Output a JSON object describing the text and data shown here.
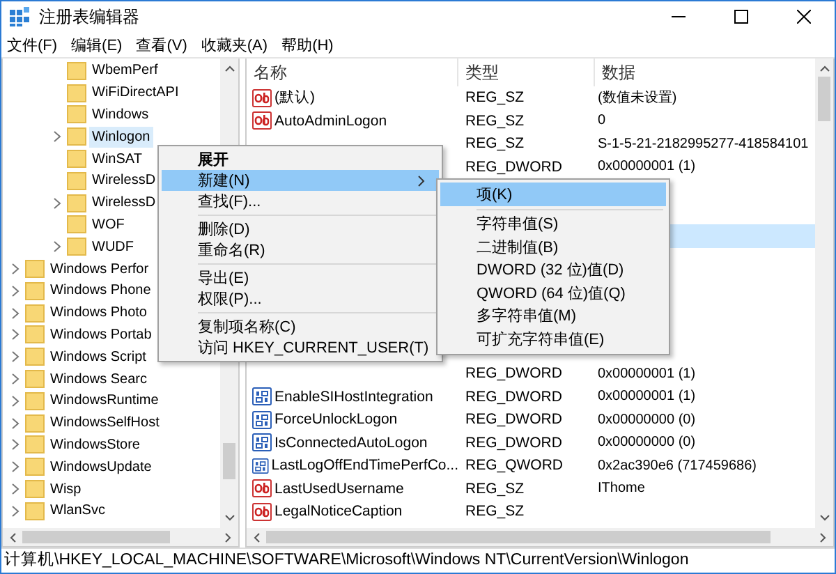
{
  "window": {
    "title": "注册表编辑器"
  },
  "menubar": [
    "文件(F)",
    "编辑(E)",
    "查看(V)",
    "收藏夹(A)",
    "帮助(H)"
  ],
  "tree": {
    "items": [
      {
        "children": [
          {
            "label": "WbemPerf",
            "has_children": false,
            "selected": false
          },
          {
            "label": "WiFiDirectAPI",
            "has_children": false,
            "selected": false
          },
          {
            "label": "Windows",
            "has_children": false,
            "selected": false
          },
          {
            "label": "Winlogon",
            "has_children": true,
            "selected": true
          },
          {
            "label": "WinSAT",
            "has_children": false,
            "selected": false
          },
          {
            "label": "WirelessD",
            "has_children": false,
            "selected": false
          },
          {
            "label": "WirelessD",
            "has_children": true,
            "selected": false
          },
          {
            "label": "WOF",
            "has_children": false,
            "selected": false
          },
          {
            "label": "WUDF",
            "has_children": true,
            "selected": false
          }
        ]
      },
      {
        "label": "Windows Perfor",
        "has_children": true,
        "selected": false
      },
      {
        "label": "Windows Phone",
        "has_children": true,
        "selected": false
      },
      {
        "label": "Windows Photo",
        "has_children": true,
        "selected": false
      },
      {
        "label": "Windows Portab",
        "has_children": true,
        "selected": false
      },
      {
        "label": "Windows Script",
        "has_children": true,
        "selected": false
      },
      {
        "label": "Windows Searc",
        "has_children": true,
        "selected": false
      },
      {
        "label": "WindowsRuntime",
        "has_children": true,
        "selected": false
      },
      {
        "label": "WindowsSelfHost",
        "has_children": true,
        "selected": false
      },
      {
        "label": "WindowsStore",
        "has_children": true,
        "selected": false
      },
      {
        "label": "WindowsUpdate",
        "has_children": true,
        "selected": false
      },
      {
        "label": "Wisp",
        "has_children": true,
        "selected": false
      },
      {
        "label": "WlanSvc",
        "has_children": true,
        "selected": false
      }
    ]
  },
  "list": {
    "columns": [
      "名称",
      "类型",
      "数据"
    ],
    "rows": [
      {
        "kind": "string",
        "name": "(默认)",
        "type": "REG_SZ",
        "data": "(数值未设置)",
        "selected": false
      },
      {
        "kind": "string",
        "name": "AutoAdminLogon",
        "type": "REG_SZ",
        "data": "0",
        "selected": false
      },
      {
        "type": "REG_SZ",
        "data": "S-1-5-21-2182995277-418584101",
        "selected": false
      },
      {
        "type": "REG_DWORD",
        "data": "0x00000001 (1)",
        "selected": false
      },
      {
        "selected": false
      },
      {
        "selected": false
      },
      {
        "selected": true
      },
      {
        "selected": false
      },
      {
        "selected": false
      },
      {
        "selected": false
      },
      {
        "selected": false
      },
      {
        "selected": false
      },
      {
        "type": "REG_DWORD",
        "data": "0x00000001 (1)",
        "selected": false
      },
      {
        "kind": "binary",
        "name": "EnableSIHostIntegration",
        "type": "REG_DWORD",
        "data": "0x00000001 (1)",
        "selected": false
      },
      {
        "kind": "binary",
        "name": "ForceUnlockLogon",
        "type": "REG_DWORD",
        "data": "0x00000000 (0)",
        "selected": false
      },
      {
        "kind": "binary",
        "name": "IsConnectedAutoLogon",
        "type": "REG_DWORD",
        "data": "0x00000000 (0)",
        "selected": false
      },
      {
        "kind": "binary",
        "name": "LastLogOffEndTimePerfCo...",
        "type": "REG_QWORD",
        "data": "0x2ac390e6 (717459686)",
        "selected": false
      },
      {
        "kind": "string",
        "name": "LastUsedUsername",
        "type": "REG_SZ",
        "data": "IThome",
        "selected": false
      },
      {
        "kind": "string",
        "name": "LegalNoticeCaption",
        "type": "REG_SZ",
        "selected": false
      }
    ]
  },
  "context_menu": {
    "items": [
      {
        "kind": "item",
        "label": "展开",
        "default": true,
        "selected": false
      },
      {
        "kind": "item",
        "label": "新建(N)",
        "submenu": true,
        "selected": true
      },
      {
        "kind": "item",
        "label": "查找(F)...",
        "selected": false
      },
      {
        "kind": "separator"
      },
      {
        "kind": "item",
        "label": "删除(D)",
        "selected": false
      },
      {
        "kind": "item",
        "label": "重命名(R)",
        "selected": false
      },
      {
        "kind": "separator"
      },
      {
        "kind": "item",
        "label": "导出(E)",
        "selected": false
      },
      {
        "kind": "item",
        "label": "权限(P)...",
        "selected": false
      },
      {
        "kind": "separator"
      },
      {
        "kind": "item",
        "label": "复制项名称(C)",
        "selected": false
      },
      {
        "kind": "item",
        "label": "访问 HKEY_CURRENT_USER(T)",
        "selected": false
      }
    ]
  },
  "submenu": {
    "items": [
      {
        "kind": "item",
        "label": "项(K)",
        "selected": true
      },
      {
        "kind": "separator"
      },
      {
        "kind": "item",
        "label": "字符串值(S)",
        "selected": false
      },
      {
        "kind": "item",
        "label": "二进制值(B)",
        "selected": false
      },
      {
        "kind": "item",
        "label": "DWORD (32 位)值(D)",
        "selected": false
      },
      {
        "kind": "item",
        "label": "QWORD (64 位)值(Q)",
        "selected": false
      },
      {
        "kind": "item",
        "label": "多字符串值(M)",
        "selected": false
      },
      {
        "kind": "item",
        "label": "可扩充字符串值(E)",
        "selected": false
      }
    ]
  },
  "status_bar": "计算机\\HKEY_LOCAL_MACHINE\\SOFTWARE\\Microsoft\\Windows NT\\CurrentVersion\\Winlogon"
}
